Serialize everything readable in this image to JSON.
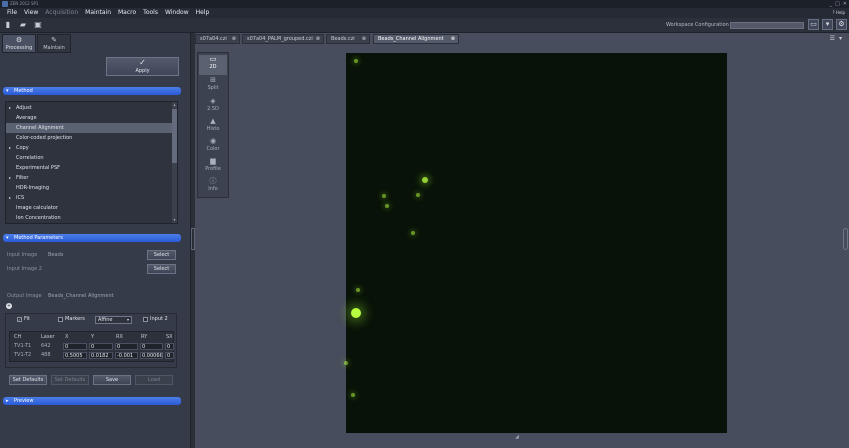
{
  "window": {
    "title": "ZEN 2012 SP1",
    "controls": [
      "_",
      "□",
      "✕"
    ]
  },
  "menu": {
    "items": [
      "File",
      "View",
      "Acquisition",
      "Maintain",
      "Macro",
      "Tools",
      "Window",
      "Help"
    ],
    "right": "? Help"
  },
  "toolbar": {
    "workspace_label": "Workspace Configuration",
    "buttons_right": [
      "▭",
      "▾",
      "⚙"
    ]
  },
  "left_tabs": {
    "processing": "Processing",
    "maintain": "Maintain"
  },
  "apply": {
    "label": "Apply",
    "icon": "✓"
  },
  "method": {
    "header": "Method",
    "items": [
      {
        "label": "Adjust",
        "expand": "▸"
      },
      {
        "label": "Average",
        "expand": ""
      },
      {
        "label": "Channel Alignment",
        "expand": "",
        "selected": true
      },
      {
        "label": "Color-coded projection",
        "expand": ""
      },
      {
        "label": "Copy",
        "expand": "▸"
      },
      {
        "label": "Correlation",
        "expand": ""
      },
      {
        "label": "Experimental PSF",
        "expand": ""
      },
      {
        "label": "Filter",
        "expand": "▸"
      },
      {
        "label": "HDR-Imaging",
        "expand": ""
      },
      {
        "label": "ICS",
        "expand": "▸"
      },
      {
        "label": "Image calculator",
        "expand": ""
      },
      {
        "label": "Ion Concentration",
        "expand": ""
      }
    ]
  },
  "params": {
    "header": "Method Parameters",
    "input1_label": "Input Image",
    "input1_value": "Beads",
    "input2_label": "Input Image 2",
    "input2_value": "",
    "output_label": "Output Image",
    "output_value": "Beads_Channel Alignment",
    "select_label": "Select",
    "fit_label": "Fit",
    "markers_label": "Markers",
    "transform": "Affine",
    "input2_chk": "Input 2",
    "table": {
      "headers": [
        "CH",
        "Laser",
        "X",
        "Y",
        "RX",
        "RY",
        "SX"
      ],
      "rows": [
        [
          "TV1-T1",
          "642",
          "0",
          "0",
          "0",
          "0",
          "0"
        ],
        [
          "TV1-T2",
          "488",
          "0.5005",
          "0.0182",
          "-0.001",
          "0.0006€",
          "0"
        ]
      ]
    },
    "buttons": [
      "Set Defaults",
      "Set Defaults",
      "Save",
      "Load"
    ]
  },
  "preview": {
    "header": "Preview"
  },
  "doc_tabs": [
    "s07a04.czi",
    "s07a04_PALM_grouped.czi",
    "Beads.czi",
    "Beads_Channel Alignment"
  ],
  "doc_tab_icons": [
    "☰",
    "▾"
  ],
  "view_tools": [
    {
      "icon": "▭",
      "label": "2D",
      "active": true
    },
    {
      "icon": "⊞",
      "label": "Split"
    },
    {
      "icon": "◈",
      "label": "2.5D"
    },
    {
      "icon": "▲",
      "label": "Histo"
    },
    {
      "icon": "◉",
      "label": "Color"
    },
    {
      "icon": "▆",
      "label": "Profile"
    },
    {
      "icon": "ⓘ",
      "label": "Info"
    }
  ],
  "image": {
    "background": "#081208",
    "bead_color": "#b8ff40"
  }
}
